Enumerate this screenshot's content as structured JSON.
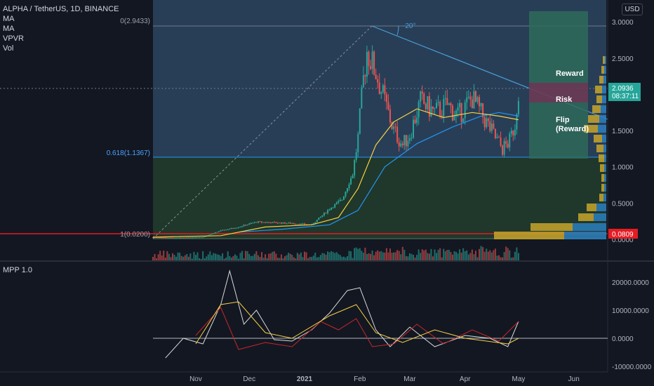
{
  "header": {
    "symbol": "ALPHA / TetherUS, 1D, BINANCE",
    "indicators": [
      "MA",
      "MA",
      "VPVR",
      "Vol"
    ],
    "currency_badge": "USD"
  },
  "price_axis": {
    "ticks": [
      "3.0000",
      "2.5000",
      "2.0000",
      "1.5000",
      "1.0000",
      "0.5000",
      "0.0000"
    ],
    "last_price": "2.0936",
    "countdown": "08:37:11",
    "marked_price": "0.0809"
  },
  "fib": {
    "level0": "0(2.9433)",
    "level618": "0.618(1.1367)",
    "level1": "1(0.0200)"
  },
  "annotations": {
    "angle": "-20°",
    "reward": "Reward",
    "risk": "Risk",
    "flip_line1": "Flip",
    "flip_line2": "(Reward)"
  },
  "time_axis": [
    "Nov",
    "Dec",
    "2021",
    "Feb",
    "Mar",
    "Apr",
    "May",
    "Jun"
  ],
  "mpp": {
    "label": "MPP 1.0",
    "ticks": [
      "20000.0000",
      "10000.0000",
      "0.0000",
      "-10000.0000"
    ]
  },
  "colors": {
    "background": "#131722",
    "up": "#26a69a",
    "down": "#ef5350",
    "ma_fast": "#f5d142",
    "ma_slow": "#2196f3",
    "fib_line": "#2196f3",
    "vpvr_yellow": "#c8a52a",
    "vpvr_blue": "#2a7fc0",
    "badge_teal": "#26a69a",
    "badge_red": "#e51c23"
  },
  "chart_data": {
    "type": "candlestick",
    "x_range": [
      "2020-10-08",
      "2021-06-20"
    ],
    "y_range": [
      0,
      3.2
    ],
    "close_series": [
      {
        "date": "2020-10-08",
        "close": 0.03
      },
      {
        "date": "2020-10-20",
        "close": 0.02
      },
      {
        "date": "2020-11-05",
        "close": 0.03
      },
      {
        "date": "2020-11-15",
        "close": 0.12
      },
      {
        "date": "2020-11-25",
        "close": 0.17
      },
      {
        "date": "2020-12-05",
        "close": 0.24
      },
      {
        "date": "2020-12-15",
        "close": 0.23
      },
      {
        "date": "2020-12-25",
        "close": 0.22
      },
      {
        "date": "2021-01-05",
        "close": 0.2
      },
      {
        "date": "2021-01-15",
        "close": 0.42
      },
      {
        "date": "2021-01-22",
        "close": 0.55
      },
      {
        "date": "2021-01-28",
        "close": 0.9
      },
      {
        "date": "2021-01-31",
        "close": 1.4
      },
      {
        "date": "2021-02-03",
        "close": 2.2
      },
      {
        "date": "2021-02-05",
        "close": 2.6
      },
      {
        "date": "2021-02-10",
        "close": 2.3
      },
      {
        "date": "2021-02-15",
        "close": 1.9
      },
      {
        "date": "2021-02-20",
        "close": 1.5
      },
      {
        "date": "2021-02-25",
        "close": 1.3
      },
      {
        "date": "2021-03-01",
        "close": 1.45
      },
      {
        "date": "2021-03-07",
        "close": 1.9
      },
      {
        "date": "2021-03-15",
        "close": 1.75
      },
      {
        "date": "2021-03-22",
        "close": 1.85
      },
      {
        "date": "2021-03-28",
        "close": 1.7
      },
      {
        "date": "2021-04-05",
        "close": 1.95
      },
      {
        "date": "2021-04-12",
        "close": 1.65
      },
      {
        "date": "2021-04-18",
        "close": 1.4
      },
      {
        "date": "2021-04-22",
        "close": 1.25
      },
      {
        "date": "2021-04-26",
        "close": 1.35
      },
      {
        "date": "2021-04-29",
        "close": 1.6
      },
      {
        "date": "2021-05-01",
        "close": 2.09
      }
    ],
    "ma_fast": [
      {
        "date": "2020-10-08",
        "v": 0.03
      },
      {
        "date": "2020-11-15",
        "v": 0.05
      },
      {
        "date": "2020-12-10",
        "v": 0.17
      },
      {
        "date": "2021-01-05",
        "v": 0.2
      },
      {
        "date": "2021-01-20",
        "v": 0.3
      },
      {
        "date": "2021-01-31",
        "v": 0.7
      },
      {
        "date": "2021-02-10",
        "v": 1.3
      },
      {
        "date": "2021-02-20",
        "v": 1.62
      },
      {
        "date": "2021-03-05",
        "v": 1.8
      },
      {
        "date": "2021-03-20",
        "v": 1.68
      },
      {
        "date": "2021-04-05",
        "v": 1.75
      },
      {
        "date": "2021-04-20",
        "v": 1.7
      },
      {
        "date": "2021-05-01",
        "v": 1.65
      }
    ],
    "ma_slow": [
      {
        "date": "2020-11-25",
        "v": 0.1
      },
      {
        "date": "2020-12-20",
        "v": 0.14
      },
      {
        "date": "2021-01-15",
        "v": 0.2
      },
      {
        "date": "2021-01-31",
        "v": 0.4
      },
      {
        "date": "2021-02-15",
        "v": 1.0
      },
      {
        "date": "2021-03-05",
        "v": 1.32
      },
      {
        "date": "2021-03-25",
        "v": 1.55
      },
      {
        "date": "2021-04-10",
        "v": 1.7
      },
      {
        "date": "2021-04-20",
        "v": 1.75
      },
      {
        "date": "2021-05-01",
        "v": 1.7
      }
    ],
    "mpp_range": [
      -12000,
      26000
    ],
    "mpp_white": [
      {
        "date": "2020-10-15",
        "v": -7000
      },
      {
        "date": "2020-10-25",
        "v": 0
      },
      {
        "date": "2020-11-05",
        "v": -2000
      },
      {
        "date": "2020-11-15",
        "v": 12000
      },
      {
        "date": "2020-11-20",
        "v": 24000
      },
      {
        "date": "2020-11-28",
        "v": 5000
      },
      {
        "date": "2020-12-05",
        "v": 10000
      },
      {
        "date": "2020-12-15",
        "v": -500
      },
      {
        "date": "2020-12-25",
        "v": -1000
      },
      {
        "date": "2021-01-05",
        "v": 3000
      },
      {
        "date": "2021-01-15",
        "v": 9000
      },
      {
        "date": "2021-01-25",
        "v": 17000
      },
      {
        "date": "2021-02-01",
        "v": 18000
      },
      {
        "date": "2021-02-10",
        "v": 3000
      },
      {
        "date": "2021-02-18",
        "v": -3000
      },
      {
        "date": "2021-03-01",
        "v": 4000
      },
      {
        "date": "2021-03-15",
        "v": -3000
      },
      {
        "date": "2021-04-01",
        "v": 1000
      },
      {
        "date": "2021-04-15",
        "v": 0
      },
      {
        "date": "2021-04-25",
        "v": -3000
      },
      {
        "date": "2021-05-01",
        "v": 6000
      }
    ],
    "mpp_red": [
      {
        "date": "2020-11-01",
        "v": 1000
      },
      {
        "date": "2020-11-15",
        "v": 11000
      },
      {
        "date": "2020-11-25",
        "v": -4000
      },
      {
        "date": "2020-12-10",
        "v": -1500
      },
      {
        "date": "2020-12-25",
        "v": -3000
      },
      {
        "date": "2021-01-10",
        "v": 6000
      },
      {
        "date": "2021-01-20",
        "v": 3000
      },
      {
        "date": "2021-01-30",
        "v": 7000
      },
      {
        "date": "2021-02-08",
        "v": -3000
      },
      {
        "date": "2021-02-20",
        "v": -2000
      },
      {
        "date": "2021-03-05",
        "v": 5000
      },
      {
        "date": "2021-03-20",
        "v": -2000
      },
      {
        "date": "2021-04-05",
        "v": 3000
      },
      {
        "date": "2021-04-20",
        "v": -1000
      },
      {
        "date": "2021-05-01",
        "v": 6000
      }
    ],
    "mpp_yellow": [
      {
        "date": "2020-11-01",
        "v": -2000
      },
      {
        "date": "2020-11-15",
        "v": 12000
      },
      {
        "date": "2020-11-25",
        "v": 13000
      },
      {
        "date": "2020-12-10",
        "v": 2000
      },
      {
        "date": "2020-12-25",
        "v": 0
      },
      {
        "date": "2021-01-15",
        "v": 8000
      },
      {
        "date": "2021-01-30",
        "v": 12000
      },
      {
        "date": "2021-02-10",
        "v": 2000
      },
      {
        "date": "2021-02-25",
        "v": -1500
      },
      {
        "date": "2021-03-15",
        "v": 3000
      },
      {
        "date": "2021-04-01",
        "v": 0
      },
      {
        "date": "2021-04-25",
        "v": -2000
      },
      {
        "date": "2021-05-01",
        "v": 0
      }
    ]
  }
}
